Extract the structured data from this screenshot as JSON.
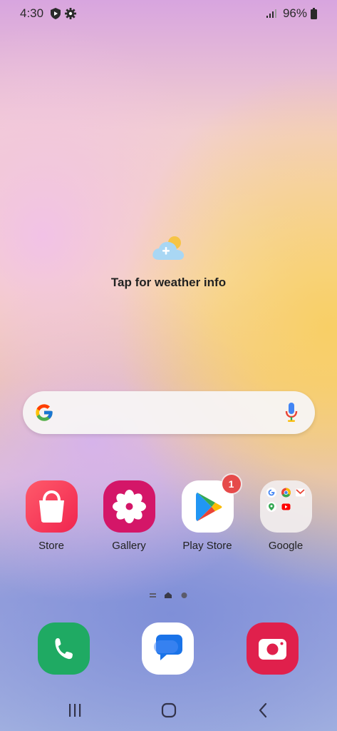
{
  "status_bar": {
    "time": "4:30",
    "battery_percent": "96%",
    "icons": [
      "shield-icon",
      "gear-icon",
      "signal-icon",
      "battery-icon"
    ]
  },
  "weather": {
    "text": "Tap for weather info",
    "icon": "weather-add-icon"
  },
  "search_bar": {
    "icons": [
      "google-g-icon",
      "mic-icon"
    ]
  },
  "apps": [
    {
      "label": "Store",
      "icon": "shopping-bag-icon",
      "color": "#f0325a"
    },
    {
      "label": "Gallery",
      "icon": "flower-icon",
      "color": "#d6156a"
    },
    {
      "label": "Play Store",
      "icon": "play-store-icon",
      "badge": "1",
      "color": "#ffffff"
    },
    {
      "label": "Google",
      "icon": "folder-icon",
      "color": "#f2eeee"
    }
  ],
  "page_indicator": {
    "pages": 2,
    "current": 1
  },
  "dock": [
    {
      "name": "phone",
      "icon": "phone-icon",
      "color": "#1faa63"
    },
    {
      "name": "messages",
      "icon": "messages-icon",
      "color": "#ffffff"
    },
    {
      "name": "camera",
      "icon": "camera-icon",
      "color": "#e0204c"
    }
  ],
  "nav_bar": {
    "icons": [
      "recents-icon",
      "home-icon",
      "back-icon"
    ]
  }
}
